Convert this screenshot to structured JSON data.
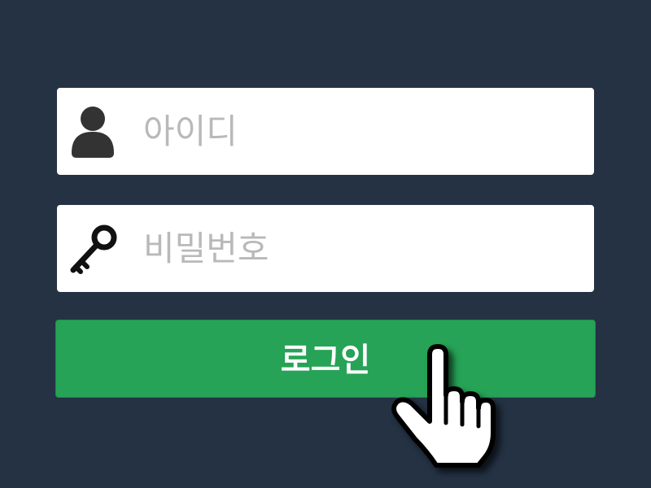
{
  "login_form": {
    "username": {
      "icon": "user-icon",
      "placeholder": "아이디",
      "value": ""
    },
    "password": {
      "icon": "key-icon",
      "placeholder": "비밀번호",
      "value": ""
    },
    "submit_label": "로그인"
  },
  "cursor": {
    "icon": "hand-pointer-icon"
  },
  "colors": {
    "background": "#243244",
    "field_background": "#ffffff",
    "placeholder": "#b9b9b9",
    "button": "#26a356",
    "button_text": "#ffffff",
    "icon": "#333333"
  }
}
